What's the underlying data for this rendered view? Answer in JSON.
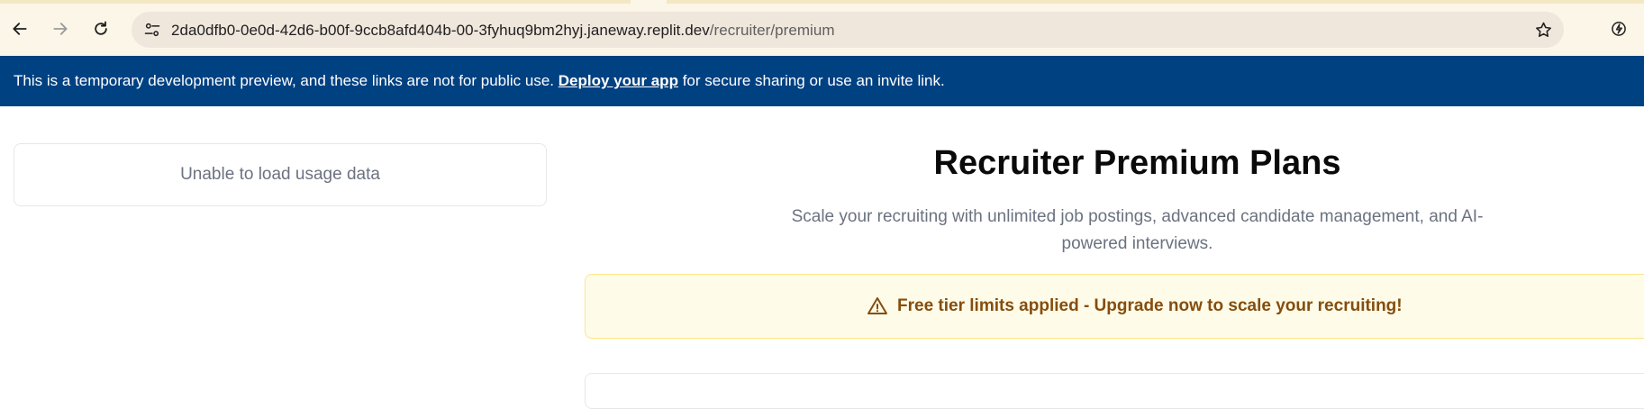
{
  "browser": {
    "url_host": "2da0dfb0-0e0d-42d6-b00f-9ccb8afd404b-00-3fyhuq9bm2hyj.janeway.replit.dev",
    "url_path": "/recruiter/premium",
    "icons": [
      "back-icon",
      "forward-icon",
      "reload-icon",
      "site-info-icon",
      "bookmark-star-icon",
      "performance-icon"
    ]
  },
  "banner": {
    "text_before": "This is a temporary development preview, and these links are not for public use.",
    "link_text": "Deploy your app",
    "text_after": "for secure sharing or use an invite link."
  },
  "usage": {
    "message": "Unable to load usage data"
  },
  "main": {
    "title": "Recruiter Premium Plans",
    "subtitle": "Scale your recruiting with unlimited job postings, advanced candidate management, and AI-powered interviews.",
    "alert": "Free tier limits applied - Upgrade now to scale your recruiting!"
  },
  "colors": {
    "banner_bg": "#004182",
    "alert_bg": "#fefce8",
    "alert_text": "#854d0e",
    "chrome_bg": "#fbf6e7",
    "omnibox_bg": "#efe6dc"
  }
}
